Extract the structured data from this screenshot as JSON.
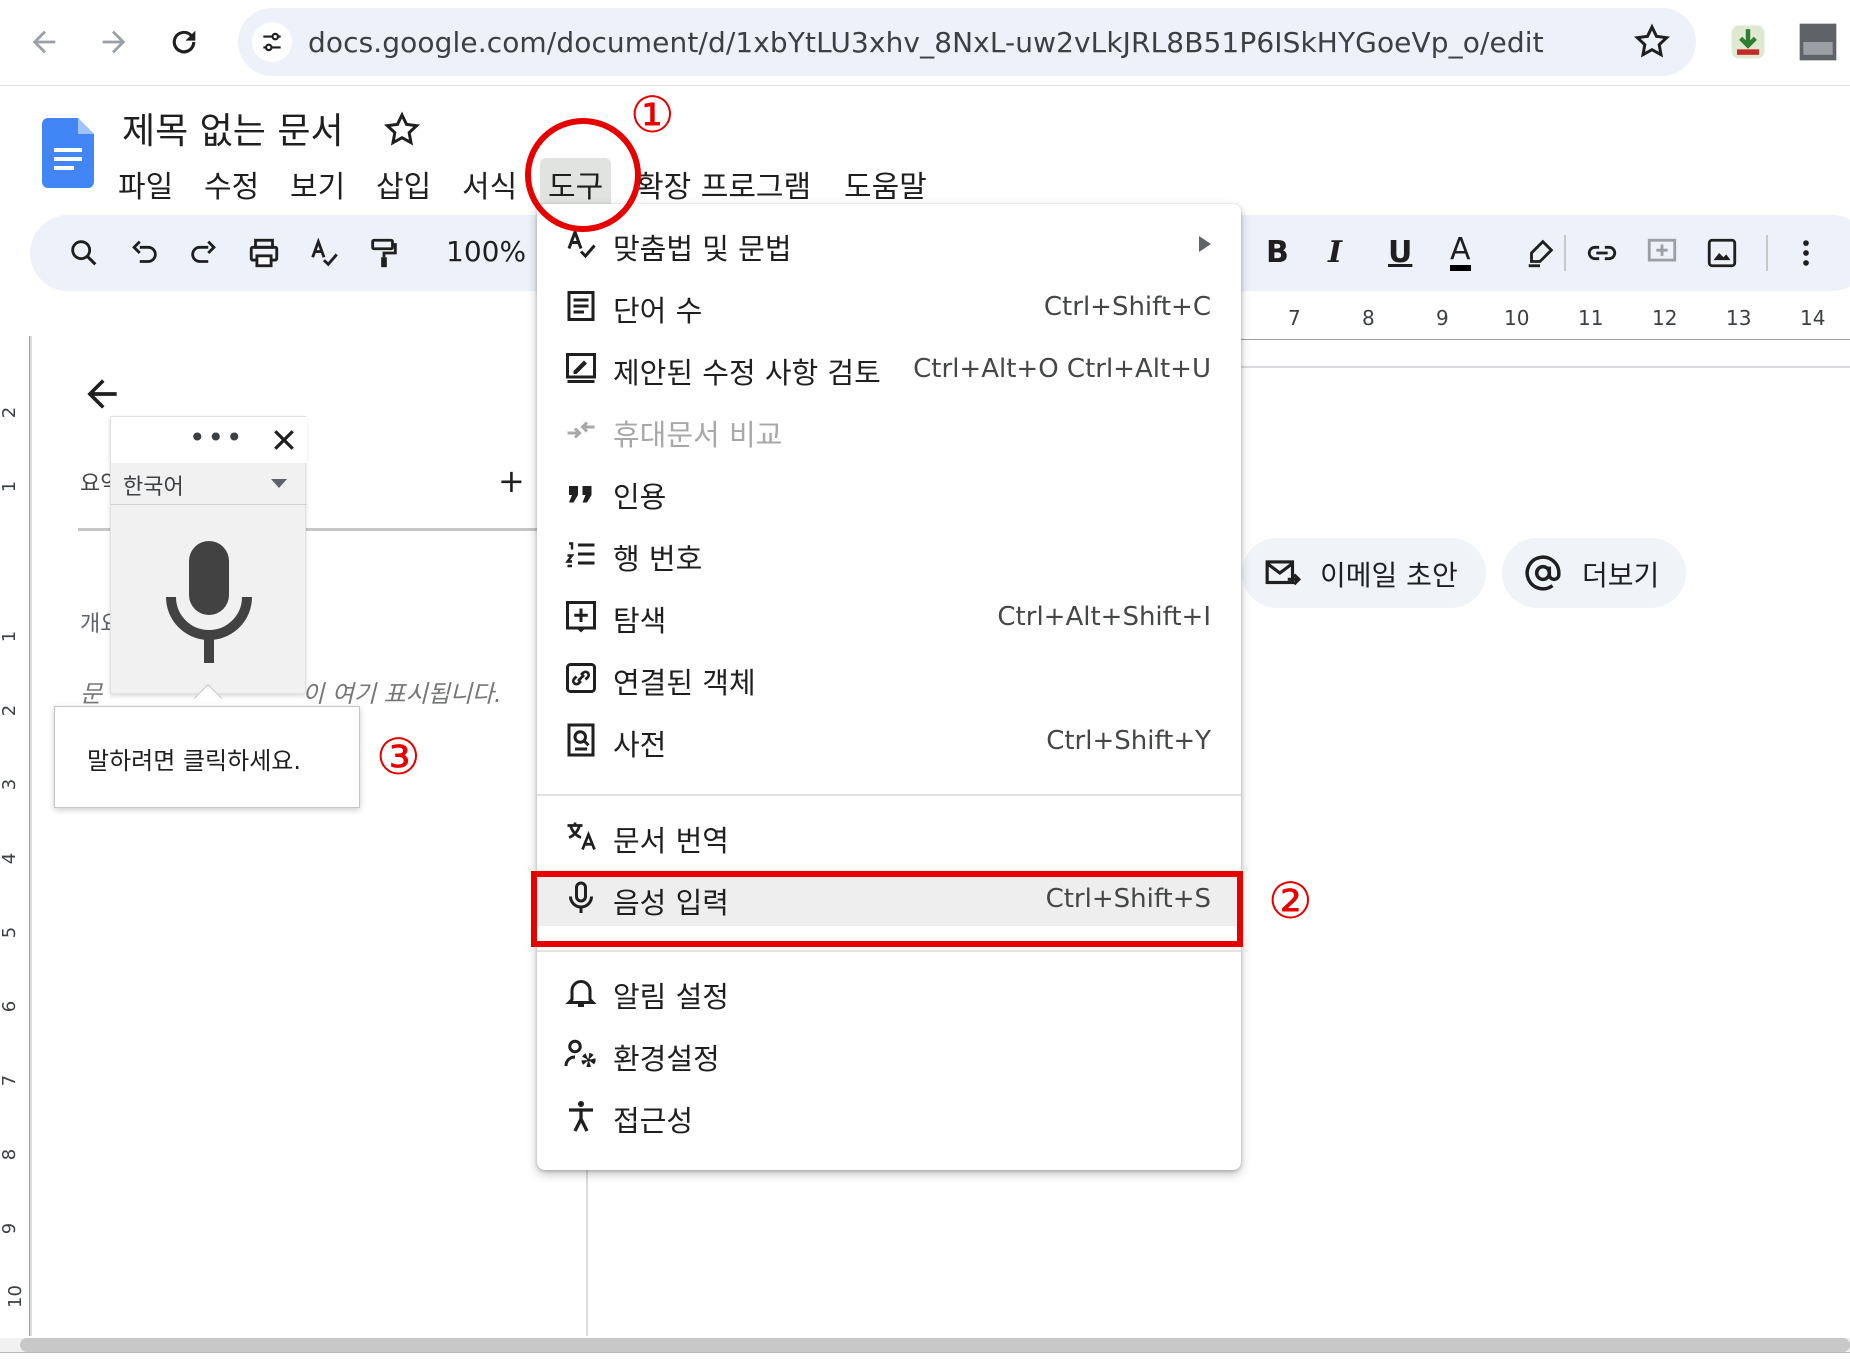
{
  "browser": {
    "url": "docs.google.com/document/d/1xbYtLU3xhv_8NxL-uw2vLkJRL8B51P6ISkHYGoeVp_o/edit"
  },
  "doc": {
    "title": "제목 없는 문서"
  },
  "menu": {
    "items": [
      "파일",
      "수정",
      "보기",
      "삽입",
      "서식",
      "도구",
      "확장 프로그램",
      "도움말"
    ],
    "active": "도구"
  },
  "toolbar": {
    "zoom": "100%",
    "bold": "B",
    "italic": "I",
    "underline": "U",
    "text_color": "A"
  },
  "ruler": {
    "horizontal": [
      "7",
      "8",
      "9",
      "10",
      "11",
      "12",
      "13",
      "14"
    ],
    "vertical": [
      "2",
      "1",
      "1",
      "2",
      "3",
      "4",
      "5",
      "6",
      "7",
      "8",
      "9",
      "10"
    ]
  },
  "outline": {
    "summary_label": "요약",
    "add": "+",
    "heading_label": "개요",
    "empty_prefix": "문",
    "empty_suffix": "이 여기 표시됩니다."
  },
  "voice_widget": {
    "more": "•••",
    "language": "한국어",
    "tooltip": "말하려면 클릭하세요."
  },
  "chips": {
    "email": "이메일 초안",
    "more": "더보기"
  },
  "tools_menu": {
    "items": [
      {
        "label": "맞춤법 및 문법",
        "shortcut": "",
        "submenu": true,
        "icon": "spellcheck-icon"
      },
      {
        "label": "단어 수",
        "shortcut": "Ctrl+Shift+C",
        "icon": "word-count-icon"
      },
      {
        "label": "제안된 수정 사항 검토",
        "shortcut": "Ctrl+Alt+O Ctrl+Alt+U",
        "icon": "review-edits-icon"
      },
      {
        "label": "휴대문서 비교",
        "shortcut": "",
        "disabled": true,
        "icon": "compare-icon"
      },
      {
        "label": "인용",
        "shortcut": "",
        "icon": "quote-icon"
      },
      {
        "label": "행 번호",
        "shortcut": "",
        "icon": "line-numbers-icon"
      },
      {
        "label": "탐색",
        "shortcut": "Ctrl+Alt+Shift+I",
        "icon": "explore-icon"
      },
      {
        "label": "연결된 객체",
        "shortcut": "",
        "icon": "linked-objects-icon"
      },
      {
        "label": "사전",
        "shortcut": "Ctrl+Shift+Y",
        "icon": "dictionary-icon"
      },
      {
        "label": "문서 번역",
        "shortcut": "",
        "icon": "translate-icon"
      },
      {
        "label": "음성 입력",
        "shortcut": "Ctrl+Shift+S",
        "icon": "microphone-icon"
      },
      {
        "label": "알림 설정",
        "shortcut": "",
        "icon": "bell-icon"
      },
      {
        "label": "환경설정",
        "shortcut": "",
        "icon": "preferences-icon"
      },
      {
        "label": "접근성",
        "shortcut": "",
        "icon": "accessibility-icon"
      }
    ]
  },
  "annotations": {
    "step1": "①",
    "step2": "②",
    "step3": "③",
    "color": "#e60000"
  },
  "colors": {
    "toolbar_bg": "#edf2fa",
    "docs_blue": "#4285f4",
    "menu_active_bg": "#e1e3e1"
  }
}
